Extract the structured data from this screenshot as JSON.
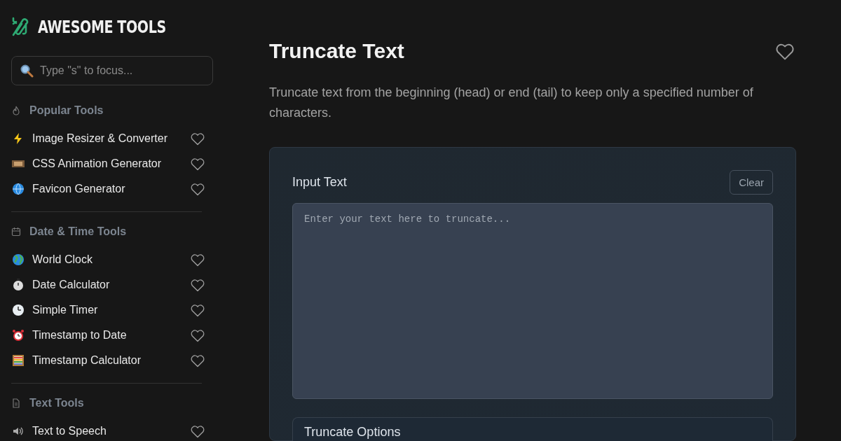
{
  "logo": {
    "text": "AWESOME TOOLS"
  },
  "search": {
    "placeholder": "Type \"s\" to focus..."
  },
  "sidebar": {
    "sections": [
      {
        "title": "Popular Tools",
        "items": [
          {
            "label": "Image Resizer & Converter",
            "favorite": false
          },
          {
            "label": "CSS Animation Generator",
            "favorite": false
          },
          {
            "label": "Favicon Generator",
            "favorite": false
          }
        ]
      },
      {
        "title": "Date & Time Tools",
        "items": [
          {
            "label": "World Clock",
            "favorite": false
          },
          {
            "label": "Date Calculator",
            "favorite": false
          },
          {
            "label": "Simple Timer",
            "favorite": false
          },
          {
            "label": "Timestamp to Date",
            "favorite": false
          },
          {
            "label": "Timestamp Calculator",
            "favorite": false
          }
        ]
      },
      {
        "title": "Text Tools",
        "items": [
          {
            "label": "Text to Speech",
            "favorite": false
          }
        ]
      }
    ]
  },
  "page": {
    "title": "Truncate Text",
    "favorite": false,
    "description": "Truncate text from the beginning (head) or end (tail) to keep only a specified number of characters."
  },
  "input": {
    "label": "Input Text",
    "clear_button": "Clear",
    "placeholder": "Enter your text here to truncate..."
  },
  "options": {
    "title": "Truncate Options"
  }
}
